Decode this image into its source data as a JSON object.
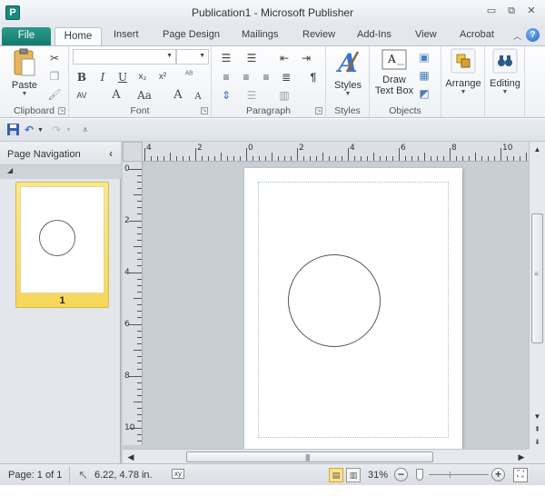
{
  "window": {
    "title": "Publication1 - Microsoft Publisher",
    "app_icon": "P",
    "controls": {
      "minimize": "▭",
      "restore": "⧉",
      "close": "✕"
    }
  },
  "tabs": {
    "file": "File",
    "items": [
      "Home",
      "Insert",
      "Page Design",
      "Mailings",
      "Review",
      "Add-Ins",
      "View",
      "Acrobat"
    ],
    "active": "Home",
    "collapse_icon": "^",
    "help_icon": "?"
  },
  "ribbon": {
    "clipboard": {
      "label": "Clipboard",
      "paste": "Paste"
    },
    "font": {
      "label": "Font",
      "font_name": "",
      "font_size": "",
      "buttons": {
        "bold": "B",
        "italic": "I",
        "underline": "U",
        "subscript": "x₂",
        "superscript": "x²",
        "char_spacing": "AV",
        "font_color": "A",
        "change_case": "Aa",
        "grow": "A",
        "shrink": "A"
      }
    },
    "paragraph": {
      "label": "Paragraph",
      "pilcrow": "¶"
    },
    "styles": {
      "label": "Styles",
      "button": "Styles"
    },
    "objects": {
      "label": "Objects",
      "draw_text_box_line1": "Draw",
      "draw_text_box_line2": "Text Box"
    },
    "arrange": {
      "button": "Arrange"
    },
    "editing": {
      "button": "Editing"
    }
  },
  "qat": {
    "save": "save",
    "undo": "undo",
    "redo": "redo",
    "customize": "customize"
  },
  "navigation": {
    "title": "Page Navigation",
    "collapse": "‹",
    "pages": [
      {
        "number": "1",
        "selected": true
      }
    ]
  },
  "rulers": {
    "horizontal_labels": [
      "4",
      "2",
      "0",
      "2",
      "4",
      "6",
      "8",
      "10"
    ],
    "vertical_labels": [
      "0",
      "2",
      "4",
      "6",
      "8",
      "10"
    ]
  },
  "status": {
    "page": "Page: 1 of 1",
    "position": "6.22, 4.78 in.",
    "size_icon": "xy",
    "zoom_level": "31%",
    "zoom_minus": "−",
    "zoom_plus": "+"
  }
}
